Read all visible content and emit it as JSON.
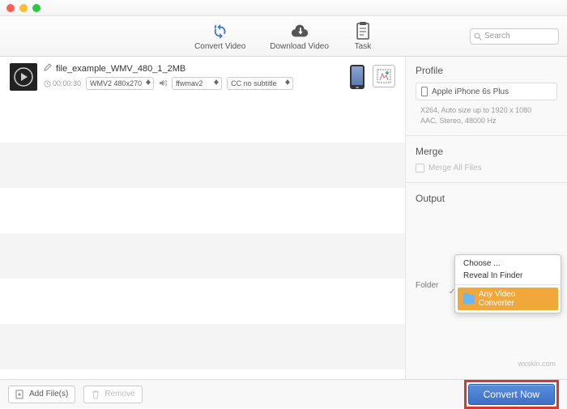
{
  "toolbar": {
    "convert_label": "Convert Video",
    "download_label": "Download Video",
    "task_label": "Task"
  },
  "search": {
    "placeholder": "Search"
  },
  "file": {
    "name": "file_example_WMV_480_1_2MB",
    "duration": "00:00:30",
    "format_sel": "WMV2 480x270",
    "audio_sel": "ffwmav2",
    "subtitle_sel": "CC no subtitle"
  },
  "right": {
    "profile_title": "Profile",
    "profile_value": "Apple iPhone 6s Plus",
    "spec_line1": "X264, Auto size up to 1920 x 1080",
    "spec_line2": "AAC, Stereo, 48000 Hz",
    "merge_title": "Merge",
    "merge_label": "Merge All Files",
    "output_title": "Output",
    "folder_label": "Folder"
  },
  "menu": {
    "choose": "Choose ...",
    "reveal": "Reveal In Finder",
    "selected": "Any Video Converter"
  },
  "footer": {
    "add": "Add File(s)",
    "remove": "Remove",
    "convert": "Convert Now"
  },
  "watermark": "wxskin.com"
}
